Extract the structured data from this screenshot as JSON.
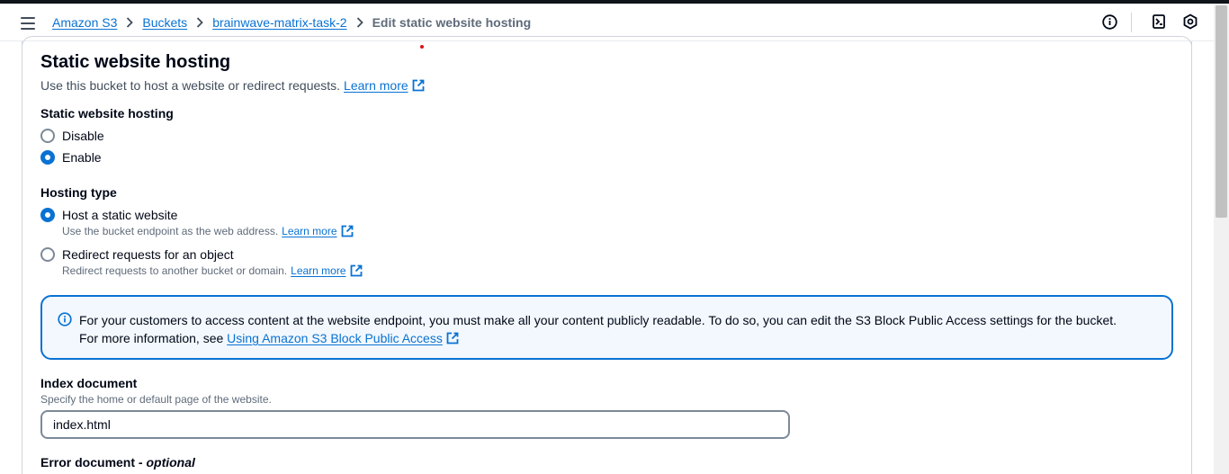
{
  "breadcrumb": {
    "items": [
      "Amazon S3",
      "Buckets",
      "brainwave-matrix-task-2"
    ],
    "current": "Edit static website hosting"
  },
  "header_icons": [
    "info-icon",
    "notifications-icon",
    "settings-icon"
  ],
  "section": {
    "title": "Static website hosting",
    "description": "Use this bucket to host a website or redirect requests.",
    "learn_more": "Learn more"
  },
  "hosting": {
    "label": "Static website hosting",
    "options": [
      {
        "label": "Disable",
        "selected": false
      },
      {
        "label": "Enable",
        "selected": true
      }
    ]
  },
  "hosting_type": {
    "label": "Hosting type",
    "options": [
      {
        "label": "Host a static website",
        "description": "Use the bucket endpoint as the web address.",
        "link": "Learn more",
        "selected": true
      },
      {
        "label": "Redirect requests for an object",
        "description": "Redirect requests to another bucket or domain.",
        "link": "Learn more",
        "selected": false
      }
    ]
  },
  "alert": {
    "line1": "For your customers to access content at the website endpoint, you must make all your content publicly readable. To do so, you can edit the S3 Block Public Access settings for the bucket.",
    "line2_prefix": "For more information, see ",
    "line2_link": "Using Amazon S3 Block Public Access"
  },
  "index_document": {
    "label": "Index document",
    "description": "Specify the home or default page of the website.",
    "value": "index.html"
  },
  "error_document": {
    "label": "Error document - ",
    "optional": "optional"
  },
  "colors": {
    "link": "#0972d3",
    "alert_bg": "#f2f8fd",
    "text": "#000716",
    "muted": "#5f6b7a"
  }
}
